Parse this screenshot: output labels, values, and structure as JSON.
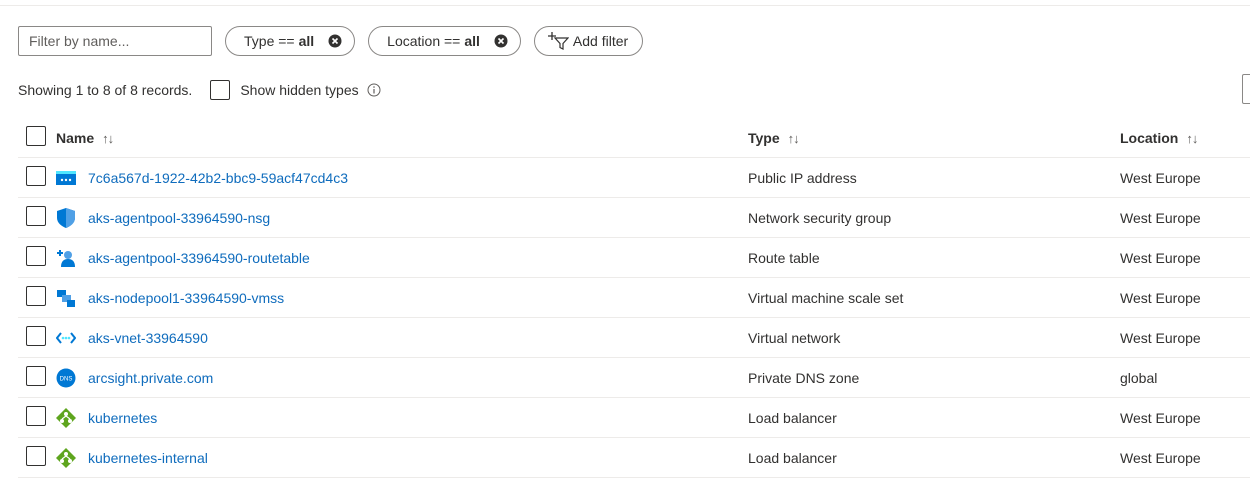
{
  "filter": {
    "placeholder": "Filter by name..."
  },
  "pills": [
    {
      "label": "Type ==",
      "value": "all"
    },
    {
      "label": "Location ==",
      "value": "all"
    }
  ],
  "add_filter_label": "Add filter",
  "status": {
    "text": "Showing 1 to 8 of 8 records.",
    "show_hidden_label": "Show hidden types"
  },
  "table": {
    "headers": {
      "name": "Name",
      "type": "Type",
      "location": "Location"
    },
    "sort_glyph": "↑↓",
    "rows": [
      {
        "name": "7c6a567d-1922-42b2-bbc9-59acf47cd4c3",
        "type": "Public IP address",
        "location": "West Europe",
        "icon": "public-ip-icon"
      },
      {
        "name": "aks-agentpool-33964590-nsg",
        "type": "Network security group",
        "location": "West Europe",
        "icon": "shield-icon"
      },
      {
        "name": "aks-agentpool-33964590-routetable",
        "type": "Route table",
        "location": "West Europe",
        "icon": "route-table-icon"
      },
      {
        "name": "aks-nodepool1-33964590-vmss",
        "type": "Virtual machine scale set",
        "location": "West Europe",
        "icon": "vmss-icon"
      },
      {
        "name": "aks-vnet-33964590",
        "type": "Virtual network",
        "location": "West Europe",
        "icon": "vnet-icon"
      },
      {
        "name": "arcsight.private.com",
        "type": "Private DNS zone",
        "location": "global",
        "icon": "dns-icon",
        "icon_text": "DNS"
      },
      {
        "name": "kubernetes",
        "type": "Load balancer",
        "location": "West Europe",
        "icon": "load-balancer-icon"
      },
      {
        "name": "kubernetes-internal",
        "type": "Load balancer",
        "location": "West Europe",
        "icon": "load-balancer-icon"
      }
    ]
  },
  "colors": {
    "link": "#0f6cbd",
    "text": "#323130",
    "border": "#8a8886",
    "divider": "#edebe9"
  }
}
